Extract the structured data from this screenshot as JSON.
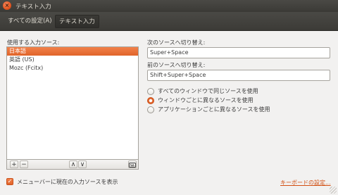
{
  "window": {
    "title": "テキスト入力",
    "close_glyph": "×"
  },
  "toolbar": {
    "all_settings": "すべての設定(A)",
    "current": "テキスト入力"
  },
  "sources": {
    "label": "使用する入力ソース:",
    "items": [
      "日本語",
      "英語 (US)",
      "Mozc (Fcitx)"
    ],
    "selected_index": 0,
    "add_glyph": "+",
    "remove_glyph": "−",
    "up_glyph": "∧",
    "down_glyph": "∨",
    "keyboard_icon": "keyboard-icon"
  },
  "shortcuts": {
    "next_label": "次のソースへ切り替え:",
    "next_value": "Super+Space",
    "prev_label": "前のソースへ切り替え:",
    "prev_value": "Shift+Super+Space"
  },
  "scope_options": {
    "items": [
      "すべてのウィンドウで同じソースを使用",
      "ウィンドウごとに異なるソースを使用",
      "アプリケーションごとに異なるソースを使用"
    ],
    "selected_index": 1
  },
  "show_in_menubar": {
    "label": "メニューバーに現在の入力ソースを表示",
    "checked": true
  },
  "keyboard_settings_link": "キーボードの設定...",
  "colors": {
    "accent": "#e0642a",
    "titlebar": "#3c3b37",
    "link": "#d24f12"
  }
}
